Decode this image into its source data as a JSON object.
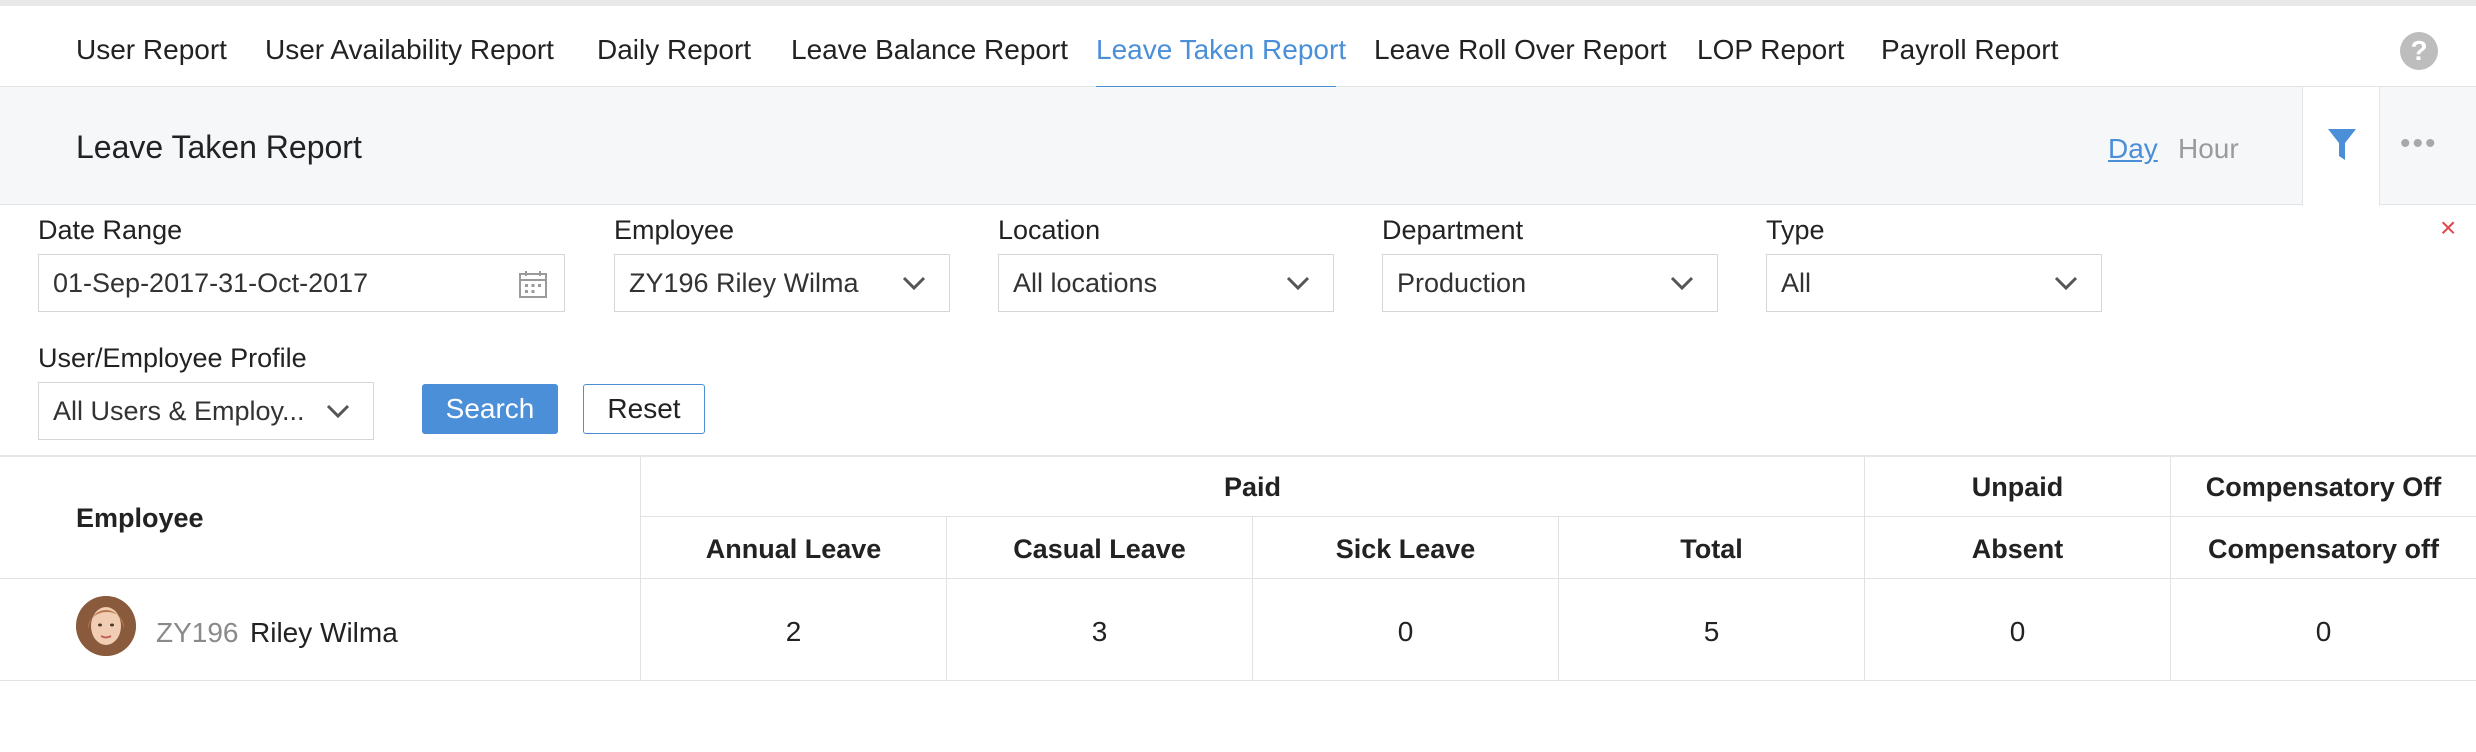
{
  "tabs": [
    {
      "label": "User Report"
    },
    {
      "label": "User Availability Report"
    },
    {
      "label": "Daily Report"
    },
    {
      "label": "Leave Balance Report"
    },
    {
      "label": "Leave Taken Report"
    },
    {
      "label": "Leave Roll Over Report"
    },
    {
      "label": "LOP Report"
    },
    {
      "label": "Payroll Report"
    }
  ],
  "active_tab": "Leave Taken Report",
  "help_label": "?",
  "titlebar": {
    "title": "Leave Taken Report",
    "unit_day": "Day",
    "unit_hour": "Hour",
    "more_label": "•••"
  },
  "filters": {
    "date_range": {
      "label": "Date Range",
      "value": "01-Sep-2017-31-Oct-2017"
    },
    "employee": {
      "label": "Employee",
      "value": "ZY196 Riley Wilma"
    },
    "location": {
      "label": "Location",
      "value": "All locations"
    },
    "department": {
      "label": "Department",
      "value": "Production"
    },
    "type": {
      "label": "Type",
      "value": "All"
    },
    "profile": {
      "label": "User/Employee Profile",
      "value": "All Users & Employ..."
    },
    "search_label": "Search",
    "reset_label": "Reset",
    "close_label": "×"
  },
  "table": {
    "employee_header": "Employee",
    "groups": {
      "paid": "Paid",
      "unpaid": "Unpaid",
      "comp": "Compensatory Off"
    },
    "columns": [
      "Annual Leave",
      "Casual Leave",
      "Sick Leave",
      "Total",
      "Absent",
      "Compensatory off"
    ],
    "rows": [
      {
        "code": "ZY196",
        "name": "Riley Wilma",
        "values": [
          "2",
          "3",
          "0",
          "5",
          "0",
          "0"
        ]
      }
    ]
  },
  "colors": {
    "accent": "#4a8fd8",
    "close": "#e0474c",
    "muted": "#9b9b9b"
  }
}
